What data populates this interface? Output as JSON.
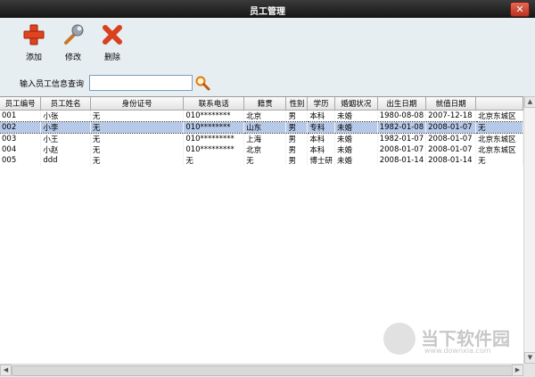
{
  "window": {
    "title": "员工管理",
    "close_glyph": "✕"
  },
  "toolbar": {
    "add_label": "添加",
    "edit_label": "修改",
    "delete_label": "删除",
    "add_icon": "plus-icon",
    "edit_icon": "wrench-icon",
    "delete_icon": "x-icon"
  },
  "search": {
    "label": "输入员工信息查询",
    "value": "",
    "icon": "magnifier-icon"
  },
  "table": {
    "columns": [
      "员工编号",
      "员工姓名",
      "身份证号",
      "联系电话",
      "籍贯",
      "性别",
      "学历",
      "婚姻状况",
      "出生日期",
      "就值日期"
    ],
    "rows": [
      [
        "001",
        "小张",
        "无",
        "010********",
        "北京",
        "男",
        "本科",
        "未婚",
        "1980-08-08",
        "2007-12-18",
        "北京东城区"
      ],
      [
        "002",
        "小李",
        "无",
        "010********",
        "山东",
        "男",
        "专科",
        "未婚",
        "1982-01-08",
        "2008-01-07",
        "无"
      ],
      [
        "003",
        "小王",
        "无",
        "010*********",
        "上海",
        "男",
        "本科",
        "未婚",
        "1982-01-07",
        "2008-01-07",
        "北京东城区"
      ],
      [
        "004",
        "小赵",
        "无",
        "010*********",
        "北京",
        "男",
        "本科",
        "未婚",
        "2008-01-07",
        "2008-01-07",
        "北京东城区"
      ],
      [
        "005",
        "ddd",
        "无",
        "无",
        "无",
        "男",
        "博士研",
        "未婚",
        "2008-01-14",
        "2008-01-14",
        "无"
      ]
    ],
    "selected_row": 1
  },
  "watermark": {
    "text": "当下软件园",
    "url": "www.downxia.com"
  },
  "colors": {
    "selection": "#b7c9e8",
    "titlebar": "#1e1e1e",
    "window_bg": "#e6eef2"
  }
}
